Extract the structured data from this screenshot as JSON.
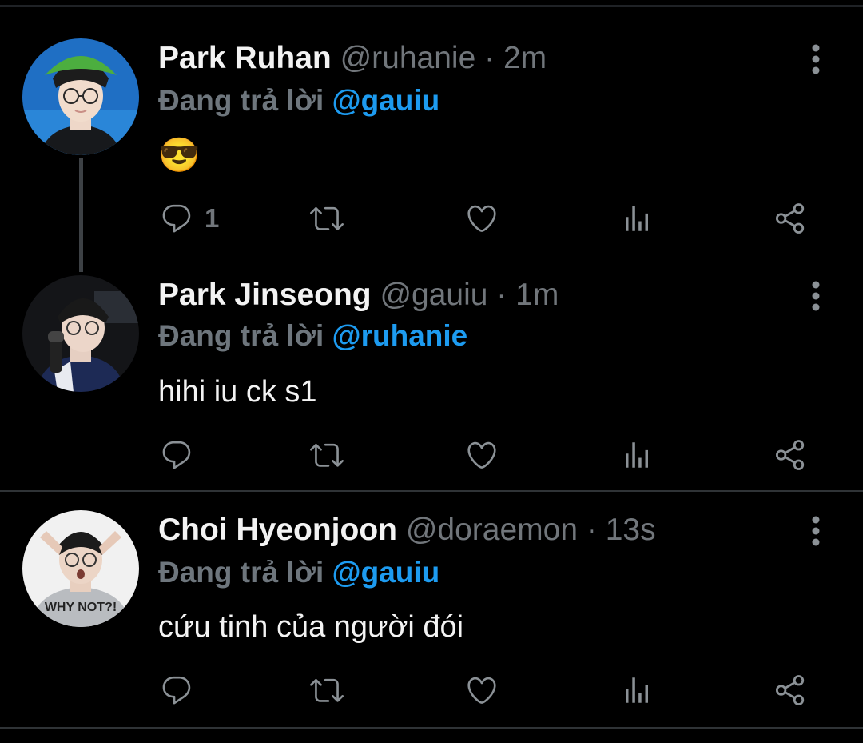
{
  "tweets": [
    {
      "name": "Park Ruhan",
      "handle": "@ruhanie",
      "sep": " · ",
      "time": "2m",
      "reply_prefix": "Đang trả lời ",
      "reply_to": "@gauiu",
      "text": "😎",
      "reply_count": "1"
    },
    {
      "name": "Park Jinseong",
      "handle": "@gauiu",
      "sep": " · ",
      "time": "1m",
      "reply_prefix": "Đang trả lời ",
      "reply_to": "@ruhanie",
      "text": "hihi iu ck s1",
      "reply_count": ""
    },
    {
      "name": "Choi Hyeonjoon",
      "handle": "@doraemon",
      "sep": " · ",
      "time": "13s",
      "reply_prefix": "Đang trả lời ",
      "reply_to": "@gauiu",
      "text": "cứu tinh của người đói",
      "reply_count": ""
    }
  ],
  "avatar_prints": [
    "WHY NOT?!"
  ],
  "icons": [
    "reply-icon",
    "retweet-icon",
    "like-icon",
    "analytics-icon",
    "share-icon",
    "more-icon"
  ],
  "colors": {
    "background": "#000000",
    "name": "#f3f3f3",
    "secondary": "#71767b",
    "mention": "#1d9bf0",
    "divider": "#2f3336"
  }
}
